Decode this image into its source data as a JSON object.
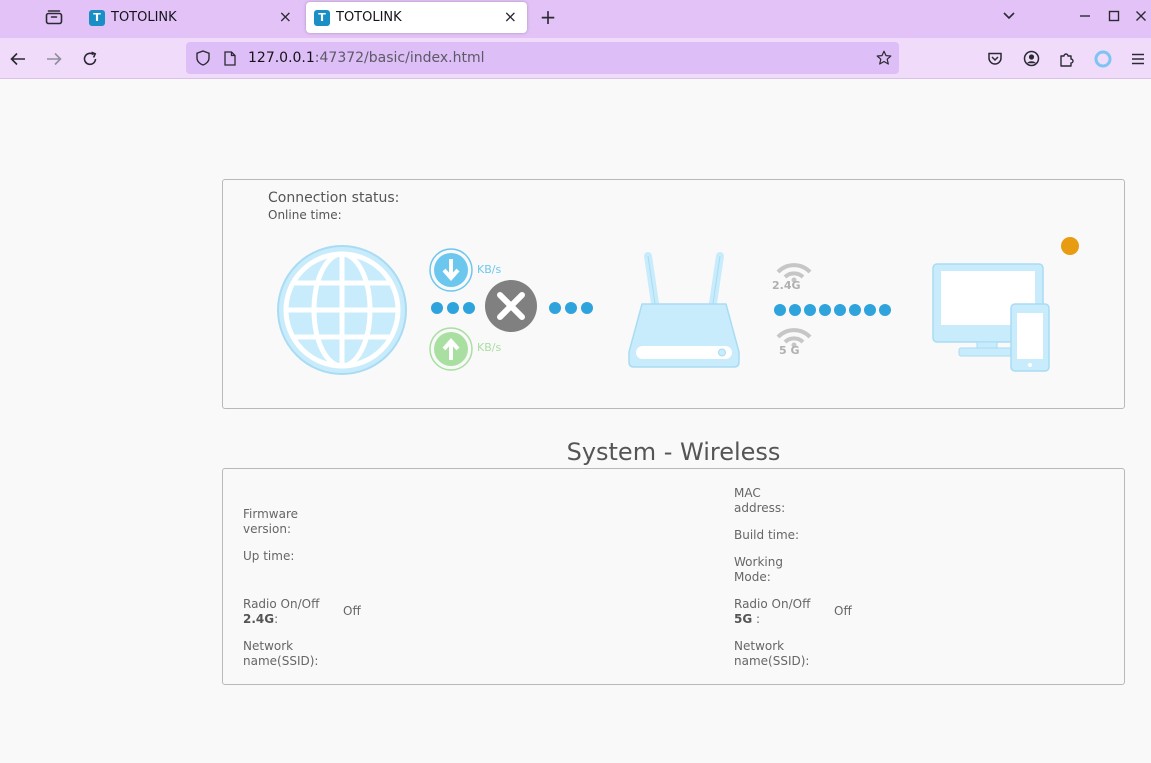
{
  "browser": {
    "tabs": [
      {
        "title": "TOTOLINK",
        "favicon": "T"
      },
      {
        "title": "TOTOLINK",
        "favicon": "T"
      }
    ],
    "url": {
      "host": "127.0.0.1",
      "rest": ":47372/basic/index.html"
    }
  },
  "connection": {
    "status_label": "Connection status:",
    "online_label": "Online time:",
    "download_unit": "KB/s",
    "upload_unit": "KB/s",
    "band_24": "2.4G",
    "band_5": "5 G",
    "status": "disconnected"
  },
  "system": {
    "title": "System - Wireless",
    "left": {
      "firmware_label_1": "Firmware",
      "firmware_label_2": "version:",
      "uptime_label": "Up time:",
      "radio24_label_1": "Radio On/Off",
      "radio24_label_2": "2.4G",
      "radio24_colon": ":",
      "radio24_value": "Off",
      "ssid_label_1": "Network",
      "ssid_label_2": "name(SSID):"
    },
    "right": {
      "mac_label_1": "MAC",
      "mac_label_2": "address:",
      "build_label": "Build time:",
      "mode_label_1": "Working",
      "mode_label_2": "Mode:",
      "radio5_label_1": "Radio On/Off",
      "radio5_label_2": "5G",
      "radio5_colon": " :",
      "radio5_value": "Off",
      "ssid_label_1": "Network",
      "ssid_label_2": "name(SSID):"
    }
  },
  "colors": {
    "accent_blue": "#2fa4dc",
    "icon_light_blue": "#c8ecfb",
    "download_blue": "#6cc7ee",
    "upload_green": "#a9dfa0",
    "error_gray": "#808080",
    "status_orange": "#e89c12",
    "browser_tabbar": "#e3c3f7"
  }
}
